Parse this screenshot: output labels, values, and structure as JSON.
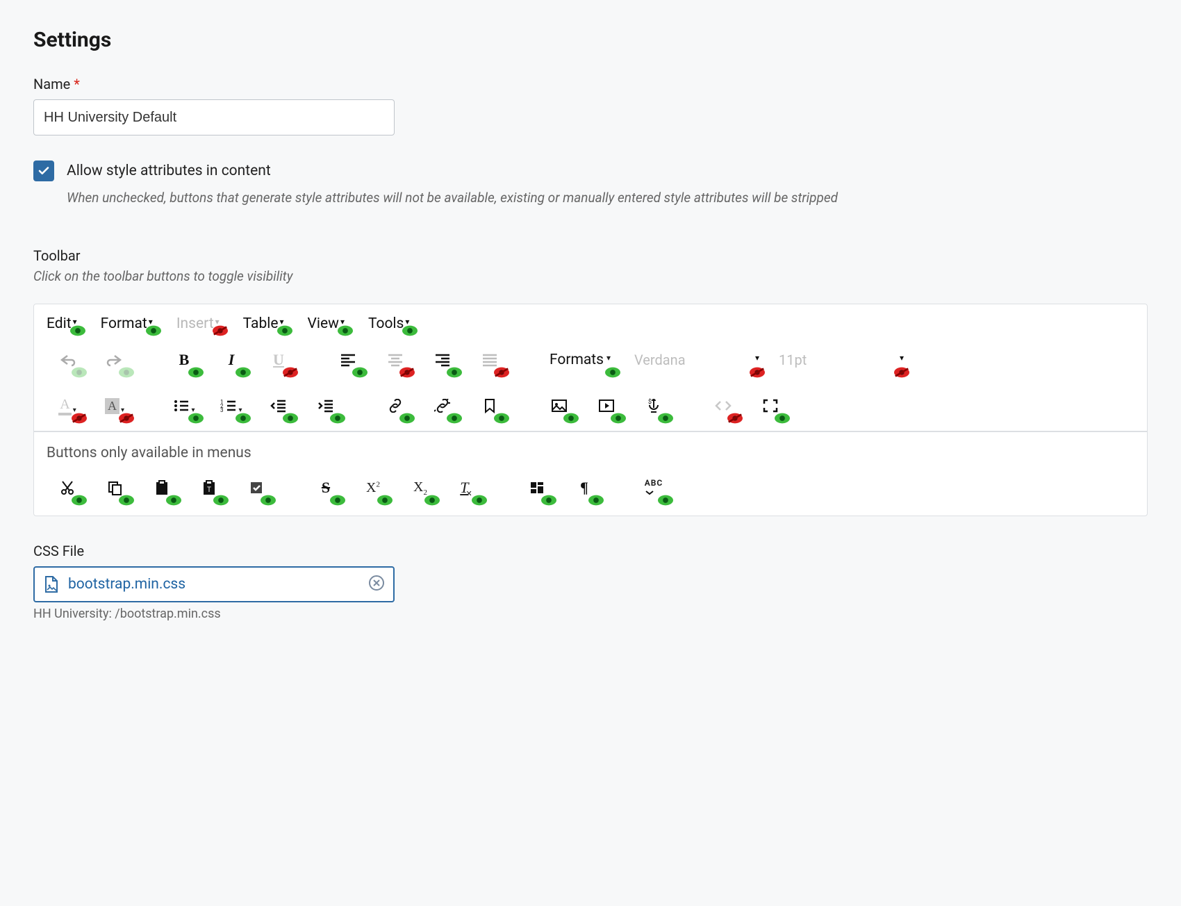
{
  "page_title": "Settings",
  "name_field": {
    "label": "Name",
    "required_marker": "*",
    "value": "HH University Default"
  },
  "allow_style": {
    "label": "Allow style attributes in content",
    "checked": true,
    "help": "When unchecked, buttons that generate style attributes will not be available, existing or manually entered style attributes will be stripped"
  },
  "toolbar_section": {
    "label": "Toolbar",
    "help": "Click on the toolbar buttons to toggle visibility"
  },
  "menus": [
    {
      "label": "Edit",
      "visible": true
    },
    {
      "label": "Format",
      "visible": true
    },
    {
      "label": "Insert",
      "visible": false
    },
    {
      "label": "Table",
      "visible": true
    },
    {
      "label": "View",
      "visible": true
    },
    {
      "label": "Tools",
      "visible": true
    }
  ],
  "row1": {
    "undo": {
      "visible": true,
      "disabled": true
    },
    "redo": {
      "visible": true,
      "disabled": true
    },
    "bold": {
      "visible": true
    },
    "italic": {
      "visible": true
    },
    "underline": {
      "visible": false
    },
    "align_left": {
      "visible": true
    },
    "align_center": {
      "visible": false
    },
    "align_right": {
      "visible": true
    },
    "align_justify": {
      "visible": false
    },
    "formats": {
      "label": "Formats",
      "visible": true
    },
    "font_family": {
      "placeholder": "Verdana",
      "visible": false
    },
    "font_size": {
      "placeholder": "11pt",
      "visible": false
    }
  },
  "row2": {
    "forecolor": {
      "visible": false
    },
    "backcolor": {
      "visible": false
    },
    "bullist": {
      "visible": true
    },
    "numlist": {
      "visible": true
    },
    "outdent": {
      "visible": true
    },
    "indent": {
      "visible": true
    },
    "link": {
      "visible": true
    },
    "unlink": {
      "visible": true
    },
    "anchor": {
      "visible": true
    },
    "image": {
      "visible": true
    },
    "media": {
      "visible": true
    },
    "embed": {
      "visible": true
    },
    "code": {
      "visible": false
    },
    "fullscreen": {
      "visible": true
    }
  },
  "menu_only": {
    "heading": "Buttons only available in menus",
    "items": [
      {
        "id": "cut",
        "visible": true
      },
      {
        "id": "copy",
        "visible": true
      },
      {
        "id": "paste",
        "visible": true
      },
      {
        "id": "paste-text",
        "visible": true
      },
      {
        "id": "select-all",
        "visible": true
      },
      {
        "id": "strikethrough",
        "visible": true
      },
      {
        "id": "superscript",
        "visible": true
      },
      {
        "id": "subscript",
        "visible": true
      },
      {
        "id": "clear-format",
        "visible": true
      },
      {
        "id": "blocks",
        "visible": true
      },
      {
        "id": "paragraph-marks",
        "visible": true
      },
      {
        "id": "spellcheck",
        "visible": true
      }
    ]
  },
  "css_file": {
    "label": "CSS File",
    "filename": "bootstrap.min.css",
    "path": "HH University: /bootstrap.min.css"
  }
}
